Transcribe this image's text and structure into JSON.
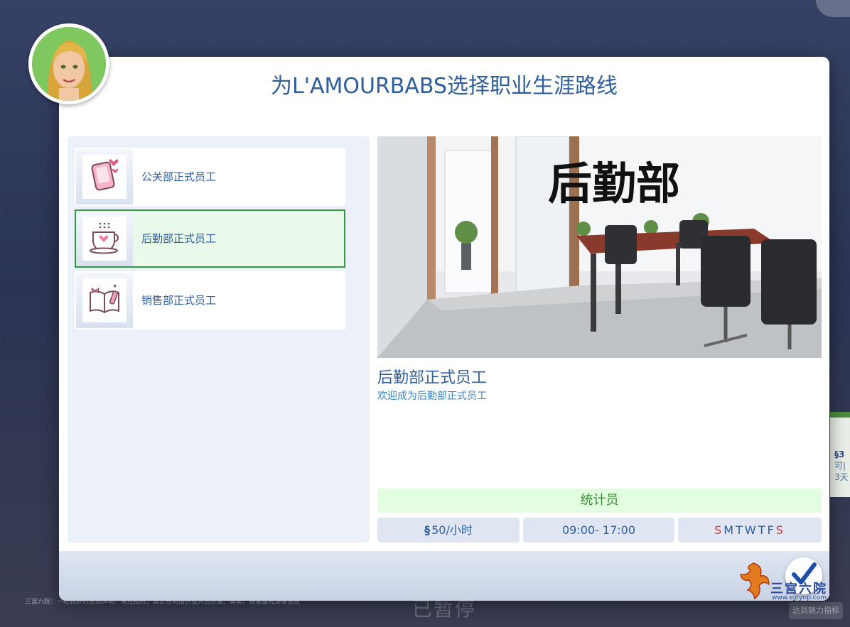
{
  "dialog": {
    "title": "为L'AMOURBABS选择职业生涯路线"
  },
  "careers": [
    {
      "label": "公关部正式员工",
      "icon": "pink-phone-hearts-icon",
      "selected": false
    },
    {
      "label": "后勤部正式员工",
      "icon": "coffee-cup-heart-icon",
      "selected": true
    },
    {
      "label": "销售部正式员工",
      "icon": "open-book-bow-icon",
      "selected": false
    }
  ],
  "detail": {
    "photo_caption": "后勤部",
    "title": "后勤部正式员工",
    "description": "欢迎成为后勤部正式员工",
    "level": "统计员",
    "pay_symbol": "§",
    "pay": "50/小时",
    "hours": "09:00- 17:00",
    "days": [
      "S",
      "M",
      "T",
      "W",
      "T",
      "F",
      "S"
    ],
    "weekend_days": [
      0,
      6
    ]
  },
  "background": {
    "paused_label": "已暂停",
    "notice": "三宫六院：一吃就胖の总总声明：未经授权，禁止任何组织或人员分发、售卖，违者追究法律责任",
    "right_strip": [
      "§3",
      "可|",
      "3天"
    ],
    "bottom_right_label": "达到魅力指标"
  },
  "watermark": {
    "text": "三宫六院",
    "url": "www.sgtynp.com"
  },
  "colors": {
    "accent_blue": "#2e5e9e",
    "selected_green": "#2f9b40",
    "level_green": "#3a8c33",
    "weekend_red": "#d23a3a"
  }
}
